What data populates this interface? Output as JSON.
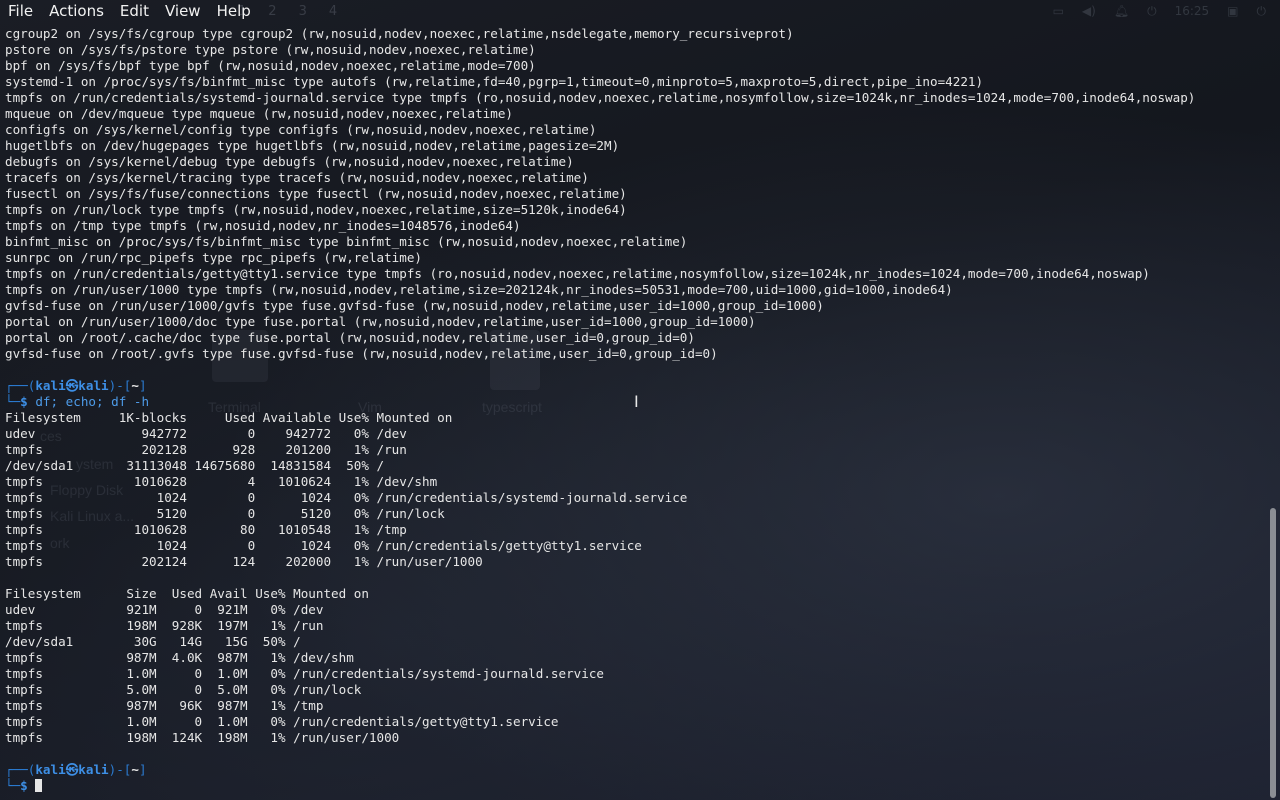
{
  "menubar": {
    "items": [
      "File",
      "Actions",
      "Edit",
      "View",
      "Help"
    ],
    "workspaces": [
      "1",
      "2",
      "3",
      "4"
    ],
    "clock": "16:25"
  },
  "desktop_ghost": {
    "labels": [
      "Terminal",
      "Vim",
      "typescript",
      "ces",
      "ystem",
      "Floppy Disk",
      "Kali Linux a...",
      "ork"
    ]
  },
  "prompt": {
    "user": "kali",
    "at": "㉿",
    "host": "kali",
    "dir": "~"
  },
  "mount_output": [
    "cgroup2 on /sys/fs/cgroup type cgroup2 (rw,nosuid,nodev,noexec,relatime,nsdelegate,memory_recursiveprot)",
    "pstore on /sys/fs/pstore type pstore (rw,nosuid,nodev,noexec,relatime)",
    "bpf on /sys/fs/bpf type bpf (rw,nosuid,nodev,noexec,relatime,mode=700)",
    "systemd-1 on /proc/sys/fs/binfmt_misc type autofs (rw,relatime,fd=40,pgrp=1,timeout=0,minproto=5,maxproto=5,direct,pipe_ino=4221)",
    "tmpfs on /run/credentials/systemd-journald.service type tmpfs (ro,nosuid,nodev,noexec,relatime,nosymfollow,size=1024k,nr_inodes=1024,mode=700,inode64,noswap)",
    "mqueue on /dev/mqueue type mqueue (rw,nosuid,nodev,noexec,relatime)",
    "configfs on /sys/kernel/config type configfs (rw,nosuid,nodev,noexec,relatime)",
    "hugetlbfs on /dev/hugepages type hugetlbfs (rw,nosuid,nodev,relatime,pagesize=2M)",
    "debugfs on /sys/kernel/debug type debugfs (rw,nosuid,nodev,noexec,relatime)",
    "tracefs on /sys/kernel/tracing type tracefs (rw,nosuid,nodev,noexec,relatime)",
    "fusectl on /sys/fs/fuse/connections type fusectl (rw,nosuid,nodev,noexec,relatime)",
    "tmpfs on /run/lock type tmpfs (rw,nosuid,nodev,noexec,relatime,size=5120k,inode64)",
    "tmpfs on /tmp type tmpfs (rw,nosuid,nodev,nr_inodes=1048576,inode64)",
    "binfmt_misc on /proc/sys/fs/binfmt_misc type binfmt_misc (rw,nosuid,nodev,noexec,relatime)",
    "sunrpc on /run/rpc_pipefs type rpc_pipefs (rw,relatime)",
    "tmpfs on /run/credentials/getty@tty1.service type tmpfs (ro,nosuid,nodev,noexec,relatime,nosymfollow,size=1024k,nr_inodes=1024,mode=700,inode64,noswap)",
    "tmpfs on /run/user/1000 type tmpfs (rw,nosuid,nodev,relatime,size=202124k,nr_inodes=50531,mode=700,uid=1000,gid=1000,inode64)",
    "gvfsd-fuse on /run/user/1000/gvfs type fuse.gvfsd-fuse (rw,nosuid,nodev,relatime,user_id=1000,group_id=1000)",
    "portal on /run/user/1000/doc type fuse.portal (rw,nosuid,nodev,relatime,user_id=1000,group_id=1000)",
    "portal on /root/.cache/doc type fuse.portal (rw,nosuid,nodev,relatime,user_id=0,group_id=0)",
    "gvfsd-fuse on /root/.gvfs type fuse.gvfsd-fuse (rw,nosuid,nodev,relatime,user_id=0,group_id=0)"
  ],
  "command": "df; echo; df -h",
  "df_output": [
    "Filesystem     1K-blocks     Used Available Use% Mounted on",
    "udev              942772        0    942772   0% /dev",
    "tmpfs             202128      928    201200   1% /run",
    "/dev/sda1       31113048 14675680  14831584  50% /",
    "tmpfs            1010628        4   1010624   1% /dev/shm",
    "tmpfs               1024        0      1024   0% /run/credentials/systemd-journald.service",
    "tmpfs               5120        0      5120   0% /run/lock",
    "tmpfs            1010628       80   1010548   1% /tmp",
    "tmpfs               1024        0      1024   0% /run/credentials/getty@tty1.service",
    "tmpfs             202124      124    202000   1% /run/user/1000"
  ],
  "dfh_output": [
    "Filesystem      Size  Used Avail Use% Mounted on",
    "udev            921M     0  921M   0% /dev",
    "tmpfs           198M  928K  197M   1% /run",
    "/dev/sda1        30G   14G   15G  50% /",
    "tmpfs           987M  4.0K  987M   1% /dev/shm",
    "tmpfs           1.0M     0  1.0M   0% /run/credentials/systemd-journald.service",
    "tmpfs           5.0M     0  5.0M   0% /run/lock",
    "tmpfs           987M   96K  987M   1% /tmp",
    "tmpfs           1.0M     0  1.0M   0% /run/credentials/getty@tty1.service",
    "tmpfs           198M  124K  198M   1% /run/user/1000"
  ],
  "colors": {
    "prompt_frame": "#2b7bd1",
    "prompt_user": "#3d8fe6",
    "command": "#4d9be8",
    "text": "#e6e6e6",
    "background": "#13161d"
  }
}
